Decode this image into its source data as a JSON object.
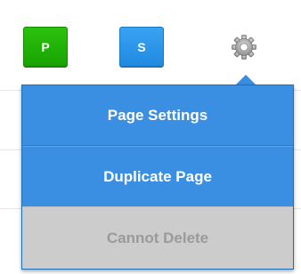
{
  "toolbar": {
    "badge_p": {
      "label": "P",
      "color": "#1aa900"
    },
    "badge_s": {
      "label": "S",
      "color": "#2a96e9"
    },
    "settings_icon": "gear-icon"
  },
  "menu": {
    "items": [
      {
        "label": "Page Settings",
        "enabled": true
      },
      {
        "label": "Duplicate Page",
        "enabled": true
      },
      {
        "label": "Cannot Delete",
        "enabled": false
      }
    ],
    "colors": {
      "active_bg": "#3b8fe3",
      "disabled_bg": "#cccccc",
      "disabled_text": "#9a9a9a"
    }
  }
}
